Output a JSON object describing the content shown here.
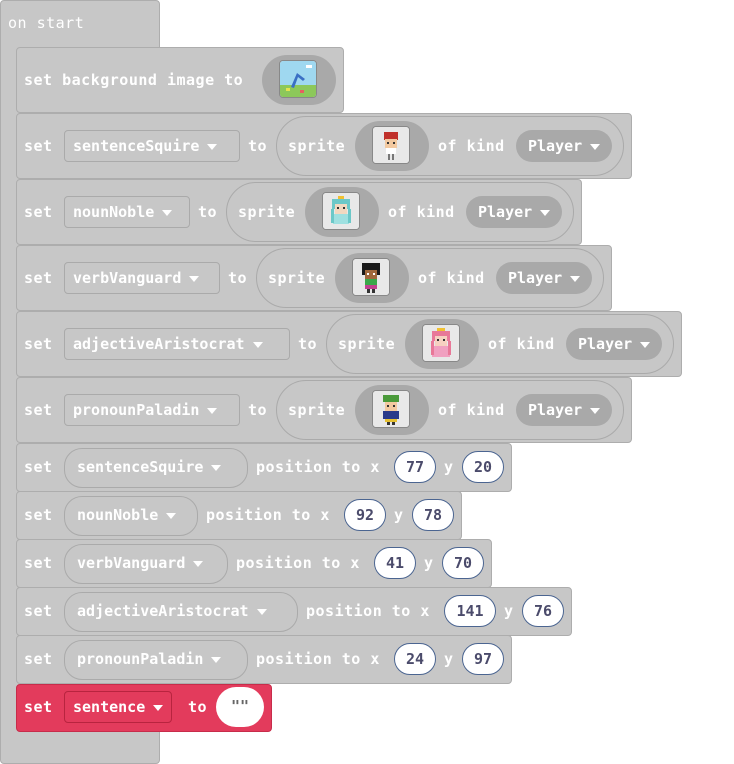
{
  "hat": {
    "label": "on start"
  },
  "bg_block": {
    "set": "set",
    "text": "set background image to",
    "image_icon": "background-image-thumbnail"
  },
  "sprite_blocks": [
    {
      "set": "set",
      "var": "sentenceSquire",
      "to": "to",
      "sprite": "sprite",
      "of_kind": "of kind",
      "kind": "Player",
      "icon": "red-haired-character"
    },
    {
      "set": "set",
      "var": "nounNoble",
      "to": "to",
      "sprite": "sprite",
      "of_kind": "of kind",
      "kind": "Player",
      "icon": "teal-haired-princess"
    },
    {
      "set": "set",
      "var": "verbVanguard",
      "to": "to",
      "sprite": "sprite",
      "of_kind": "of kind",
      "kind": "Player",
      "icon": "dark-haired-character"
    },
    {
      "set": "set",
      "var": "adjectiveAristocrat",
      "to": "to",
      "sprite": "sprite",
      "of_kind": "of kind",
      "kind": "Player",
      "icon": "pink-princess"
    },
    {
      "set": "set",
      "var": "pronounPaladin",
      "to": "to",
      "sprite": "sprite",
      "of_kind": "of kind",
      "kind": "Player",
      "icon": "green-capped-character"
    }
  ],
  "position_blocks": [
    {
      "set": "set",
      "var": "sentenceSquire",
      "label": "position to x",
      "x": "77",
      "y_label": "y",
      "y": "20"
    },
    {
      "set": "set",
      "var": "nounNoble",
      "label": "position to x",
      "x": "92",
      "y_label": "y",
      "y": "78"
    },
    {
      "set": "set",
      "var": "verbVanguard",
      "label": "position to x",
      "x": "41",
      "y_label": "y",
      "y": "70"
    },
    {
      "set": "set",
      "var": "adjectiveAristocrat",
      "label": "position to x",
      "x": "141",
      "y_label": "y",
      "y": "76"
    },
    {
      "set": "set",
      "var": "pronounPaladin",
      "label": "position to x",
      "x": "24",
      "y_label": "y",
      "y": "97"
    }
  ],
  "sentence_block": {
    "set": "set",
    "var": "sentence",
    "to": "to",
    "value": "\"\""
  },
  "colors": {
    "block": "#c7c7c7",
    "variables": "#e33b5c",
    "number_border": "#4b6591"
  }
}
